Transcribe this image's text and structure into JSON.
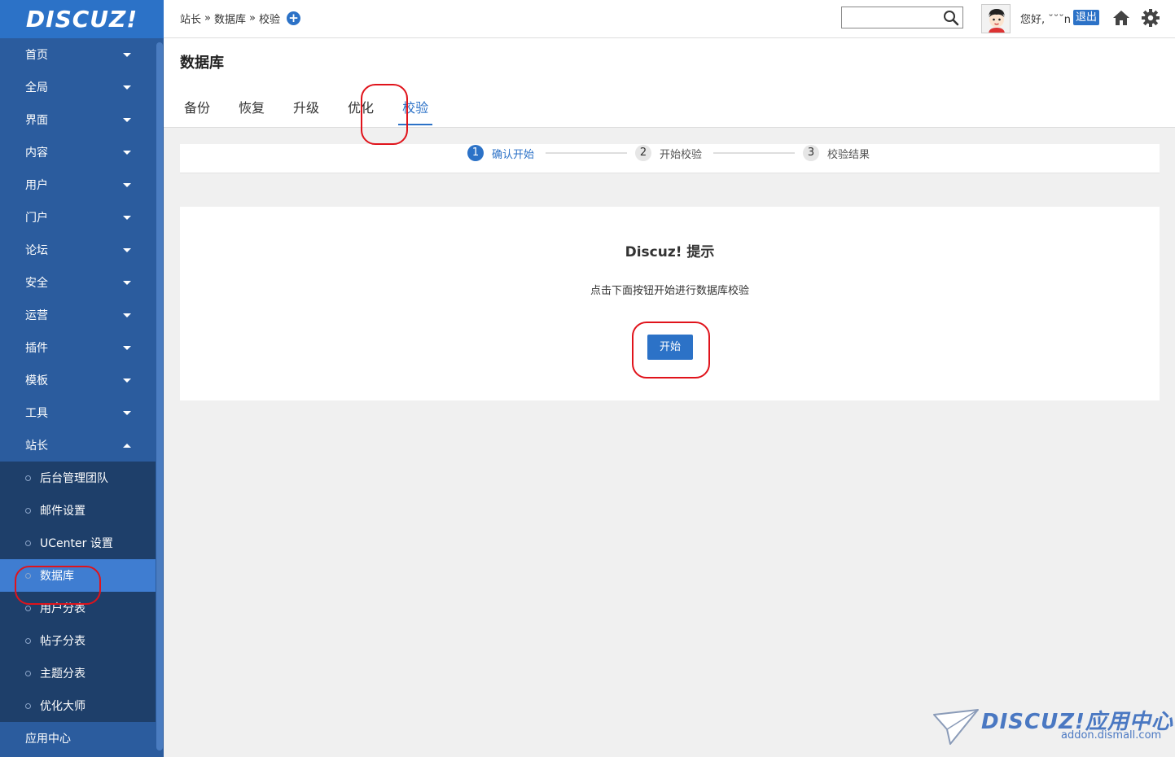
{
  "logo": {
    "text": "DISCUZ!"
  },
  "sidebar": {
    "items": [
      {
        "label": "首页"
      },
      {
        "label": "全局"
      },
      {
        "label": "界面"
      },
      {
        "label": "内容"
      },
      {
        "label": "用户"
      },
      {
        "label": "门户"
      },
      {
        "label": "论坛"
      },
      {
        "label": "安全"
      },
      {
        "label": "运营"
      },
      {
        "label": "插件"
      },
      {
        "label": "模板"
      },
      {
        "label": "工具"
      },
      {
        "label": "站长"
      }
    ],
    "sub_items": [
      {
        "label": "后台管理团队"
      },
      {
        "label": "邮件设置"
      },
      {
        "label": "UCenter 设置"
      },
      {
        "label": "数据库",
        "active": true
      },
      {
        "label": "用户分表"
      },
      {
        "label": "帖子分表"
      },
      {
        "label": "主题分表"
      },
      {
        "label": "优化大师"
      }
    ],
    "bottom_item": {
      "label": "应用中心"
    }
  },
  "header": {
    "breadcrumb": [
      "站长",
      "数据库",
      "校验"
    ],
    "breadcrumb_sep": "»",
    "search": {
      "value": "",
      "placeholder": ""
    },
    "greeting": "您好, ˘˘˘n",
    "logout_label": "退出"
  },
  "page": {
    "title": "数据库",
    "tabs": [
      {
        "label": "备份"
      },
      {
        "label": "恢复"
      },
      {
        "label": "升级"
      },
      {
        "label": "优化"
      },
      {
        "label": "校验",
        "active": true
      }
    ]
  },
  "steps": [
    {
      "num": "1",
      "label": "确认开始",
      "active": true
    },
    {
      "num": "2",
      "label": "开始校验"
    },
    {
      "num": "3",
      "label": "校验结果"
    }
  ],
  "notice": {
    "title": "Discuz! 提示",
    "message": "点击下面按钮开始进行数据库校验",
    "button_label": "开始"
  },
  "watermark": {
    "brand": "DISCUZ!应用中心",
    "url": "addon.dismall.com"
  },
  "colors": {
    "accent": "#2c72c7",
    "sidebar": "#2b5c9e",
    "sidebar_sub": "#1e3f6a",
    "annotation": "#e0131b"
  }
}
